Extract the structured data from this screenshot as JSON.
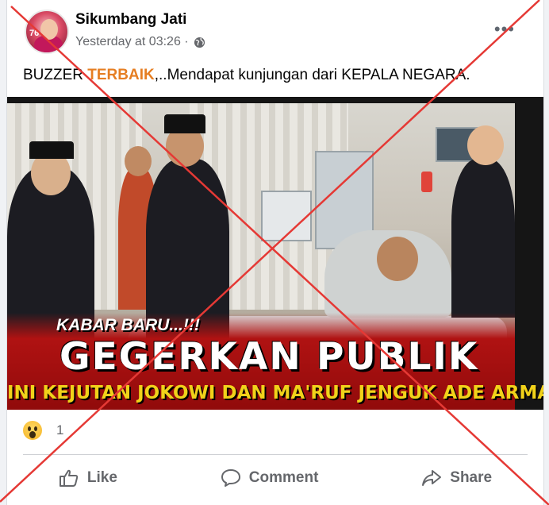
{
  "post": {
    "author": "Sikumbang Jati",
    "timestamp": "Yesterday at 03:26 ·",
    "audience_icon": "globe-icon",
    "caption_prefix": "BUZZER ",
    "caption_highlight": "TERBAIK",
    "caption_suffix": ",..Mendapat kunjungan dari KEPALA NEGARA."
  },
  "avatar": {
    "badge": "76"
  },
  "image": {
    "kicker": "KABAR BARU...!!!",
    "headline": "GEGERKAN PUBLIK",
    "subline": "INI KEJUTAN JOKOWI DAN MA'RUF JENGUK ADE ARMAN"
  },
  "reactions": {
    "icon": "wow-reaction-icon",
    "count": "1"
  },
  "actions": {
    "like": "Like",
    "comment": "Comment",
    "share": "Share"
  },
  "overlay": {
    "color": "#e53935",
    "type": "red-cross"
  },
  "colors": {
    "highlight": "#e67e22",
    "banner": "#b01212",
    "subline": "#f1d21a"
  }
}
